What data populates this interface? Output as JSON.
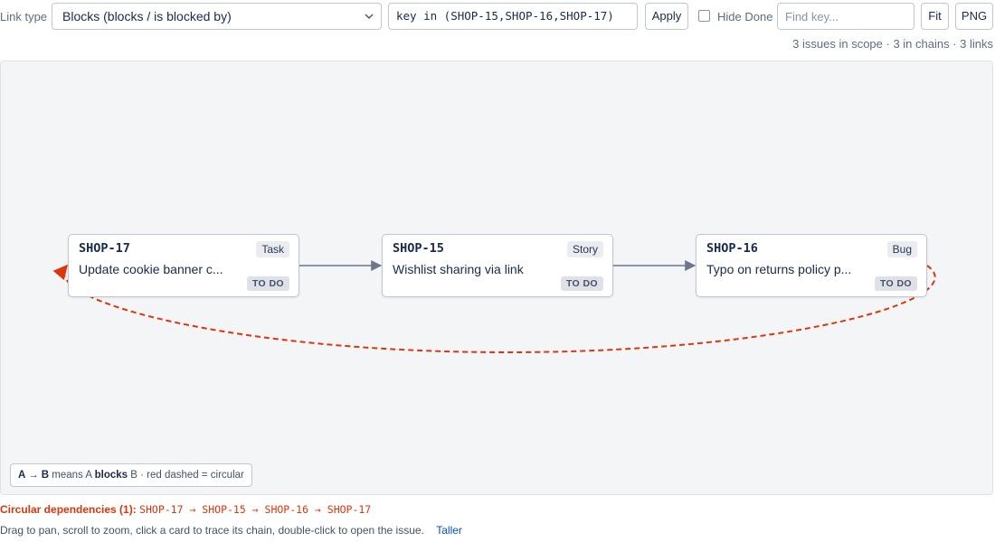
{
  "toolbar": {
    "link_type_label": "Link type",
    "link_type_value": "Blocks (blocks / is blocked by)",
    "jql_value": "key in (SHOP-15,SHOP-16,SHOP-17)",
    "apply_label": "Apply",
    "hide_done_label": "Hide Done",
    "hide_done_checked": false,
    "find_key_placeholder": "Find key...",
    "fit_label": "Fit",
    "png_label": "PNG"
  },
  "summary": "3 issues in scope · 3 in chains · 3 links",
  "cards": [
    {
      "key": "SHOP-17",
      "type": "Task",
      "title": "Update cookie banner c...",
      "status": "TO DO"
    },
    {
      "key": "SHOP-15",
      "type": "Story",
      "title": "Wishlist sharing via link",
      "status": "TO DO"
    },
    {
      "key": "SHOP-16",
      "type": "Bug",
      "title": "Typo on returns policy p...",
      "status": "TO DO"
    }
  ],
  "links": [
    {
      "from": "SHOP-17",
      "to": "SHOP-15",
      "circular": false
    },
    {
      "from": "SHOP-15",
      "to": "SHOP-16",
      "circular": false
    },
    {
      "from": "SHOP-16",
      "to": "SHOP-17",
      "circular": true
    }
  ],
  "legend": {
    "a_to_b": "A → B",
    "means_a": "means A",
    "blocks": "blocks",
    "b_rest": "B · red dashed = circular"
  },
  "circular": {
    "label": "Circular dependencies (1):",
    "path": "SHOP-17 → SHOP-15 → SHOP-16 → SHOP-17"
  },
  "help": {
    "text": "Drag to pan, scroll to zoom, click a card to trace its chain, double-click to open the issue.",
    "taller_label": "Taller"
  },
  "colors": {
    "edge": "#6b778c",
    "circular": "#de350b",
    "canvas_bg": "#f4f5f7",
    "link": "#0052cc"
  }
}
